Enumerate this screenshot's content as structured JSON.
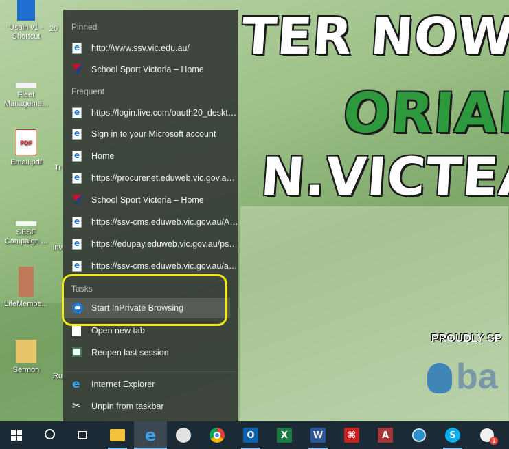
{
  "wallpaper": {
    "line1": "TER NOW",
    "line2": "ORIAN",
    "line3": "N.VICTEA",
    "proudly": "PROUDLY SP",
    "brand": "ba"
  },
  "desktop_icons": [
    {
      "label_1": "Usain v1 -",
      "label_2": "Shortcut"
    },
    {
      "label_1": "Fleet",
      "label_2": "Manageme..."
    },
    {
      "label_1": "Email.pdf",
      "label_2": ""
    },
    {
      "label_1": "SESF",
      "label_2": "Campaign ..."
    },
    {
      "label_1": "LifeMembe...",
      "label_2": ""
    },
    {
      "label_1": "Sermon",
      "label_2": ""
    }
  ],
  "desktop_partial_labels": [
    "20",
    "Tr",
    "inv",
    "Ru"
  ],
  "jumplist": {
    "pinned_header": "Pinned",
    "pinned": [
      {
        "label": "http://www.ssv.vic.edu.au/",
        "icon": "ie-page-icon"
      },
      {
        "label": "School Sport Victoria – Home",
        "icon": "ssv-icon"
      }
    ],
    "frequent_header": "Frequent",
    "frequent": [
      {
        "label": "https://login.live.com/oauth20_deskto...",
        "icon": "ie-page-icon"
      },
      {
        "label": "Sign in to your Microsoft account",
        "icon": "ie-page-icon"
      },
      {
        "label": "Home",
        "icon": "ie-page-icon"
      },
      {
        "label": "https://procurenet.eduweb.vic.gov.au/...",
        "icon": "ie-page-icon"
      },
      {
        "label": "School Sport Victoria – Home",
        "icon": "ssv-icon"
      },
      {
        "label": "https://ssv-cms.eduweb.vic.gov.au/Ab...",
        "icon": "ie-page-icon"
      },
      {
        "label": "https://edupay.eduweb.vic.gov.au/psp...",
        "icon": "ie-page-icon"
      },
      {
        "label": "https://ssv-cms.eduweb.vic.gov.au/abo...",
        "icon": "ie-page-icon"
      }
    ],
    "tasks_header": "Tasks",
    "tasks": [
      {
        "label": "Start InPrivate Browsing",
        "icon": "inprivate-icon"
      },
      {
        "label": "Open new tab",
        "icon": "new-tab-icon"
      },
      {
        "label": "Reopen last session",
        "icon": "reopen-session-icon"
      }
    ],
    "app_label": "Internet Explorer",
    "unpin_label": "Unpin from taskbar"
  },
  "taskbar": {
    "items": [
      "start-icon",
      "search-icon",
      "task-view-icon",
      "file-explorer-icon",
      "internet-explorer-icon",
      "paint-icon",
      "chrome-icon",
      "outlook-icon",
      "excel-icon",
      "word-icon",
      "acrobat-icon",
      "access-icon",
      "app-icon",
      "skype-icon",
      "notification-app-icon"
    ],
    "outlook_letter": "O",
    "excel_letter": "X",
    "word_letter": "W",
    "access_letter": "A",
    "skype_letter": "S",
    "badge_count": "1"
  },
  "colors": {
    "highlight": "#f4ea11",
    "jumplist_bg": "#373e38",
    "taskbar_bg": "#1b2a35"
  }
}
